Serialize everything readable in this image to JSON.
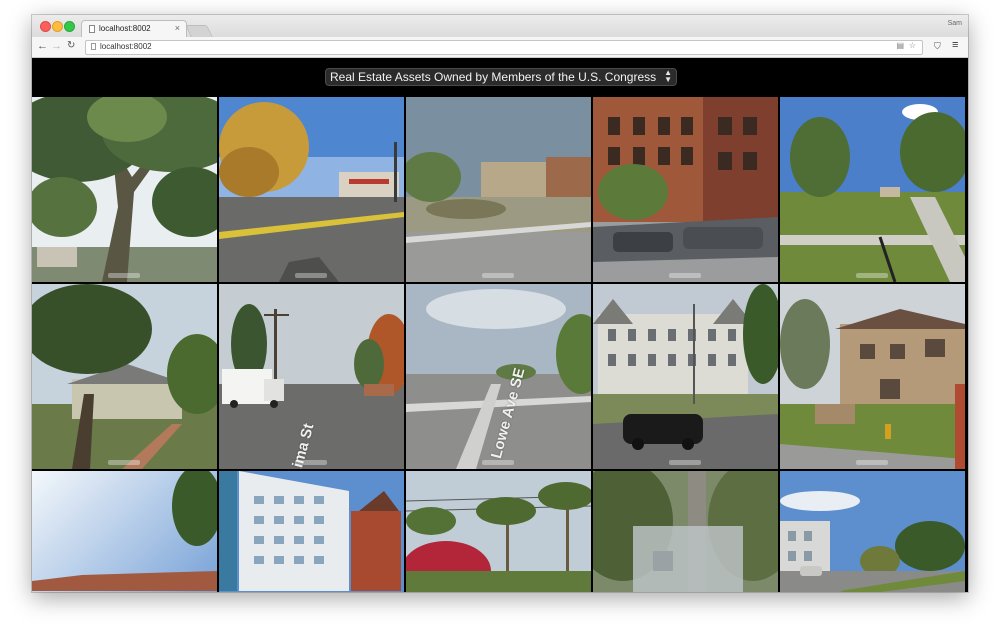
{
  "browser": {
    "tab_title": "localhost:8002",
    "tab_close": "×",
    "profile_name": "Sam",
    "url": "localhost:8002",
    "nav_back": "←",
    "nav_forward": "→",
    "nav_reload": "↻",
    "omnibox_icon_a": "▤",
    "omnibox_icon_b": "☆",
    "extension_icon": "⛉",
    "menu_icon": "≡"
  },
  "page": {
    "dataset_select": {
      "selected": "Real Estate Assets Owned by Members of the U.S. Congress",
      "arrows": "▲▼"
    },
    "photos": [
      {
        "scene": "tree-canopy"
      },
      {
        "scene": "intersection-autumn"
      },
      {
        "scene": "desert-houses"
      },
      {
        "scene": "brick-condos"
      },
      {
        "scene": "park-sidewalk"
      },
      {
        "scene": "oak-bungalow"
      },
      {
        "scene": "street-truck",
        "street_label": "Lima St"
      },
      {
        "scene": "crosswalk",
        "street_label": "Lowe Ave SE"
      },
      {
        "scene": "victorian-apartment"
      },
      {
        "scene": "townhouses"
      },
      {
        "scene": "sky-rooftop"
      },
      {
        "scene": "glass-tower"
      },
      {
        "scene": "palm-trees"
      },
      {
        "scene": "blurred-pole"
      },
      {
        "scene": "beach-road"
      }
    ]
  }
}
